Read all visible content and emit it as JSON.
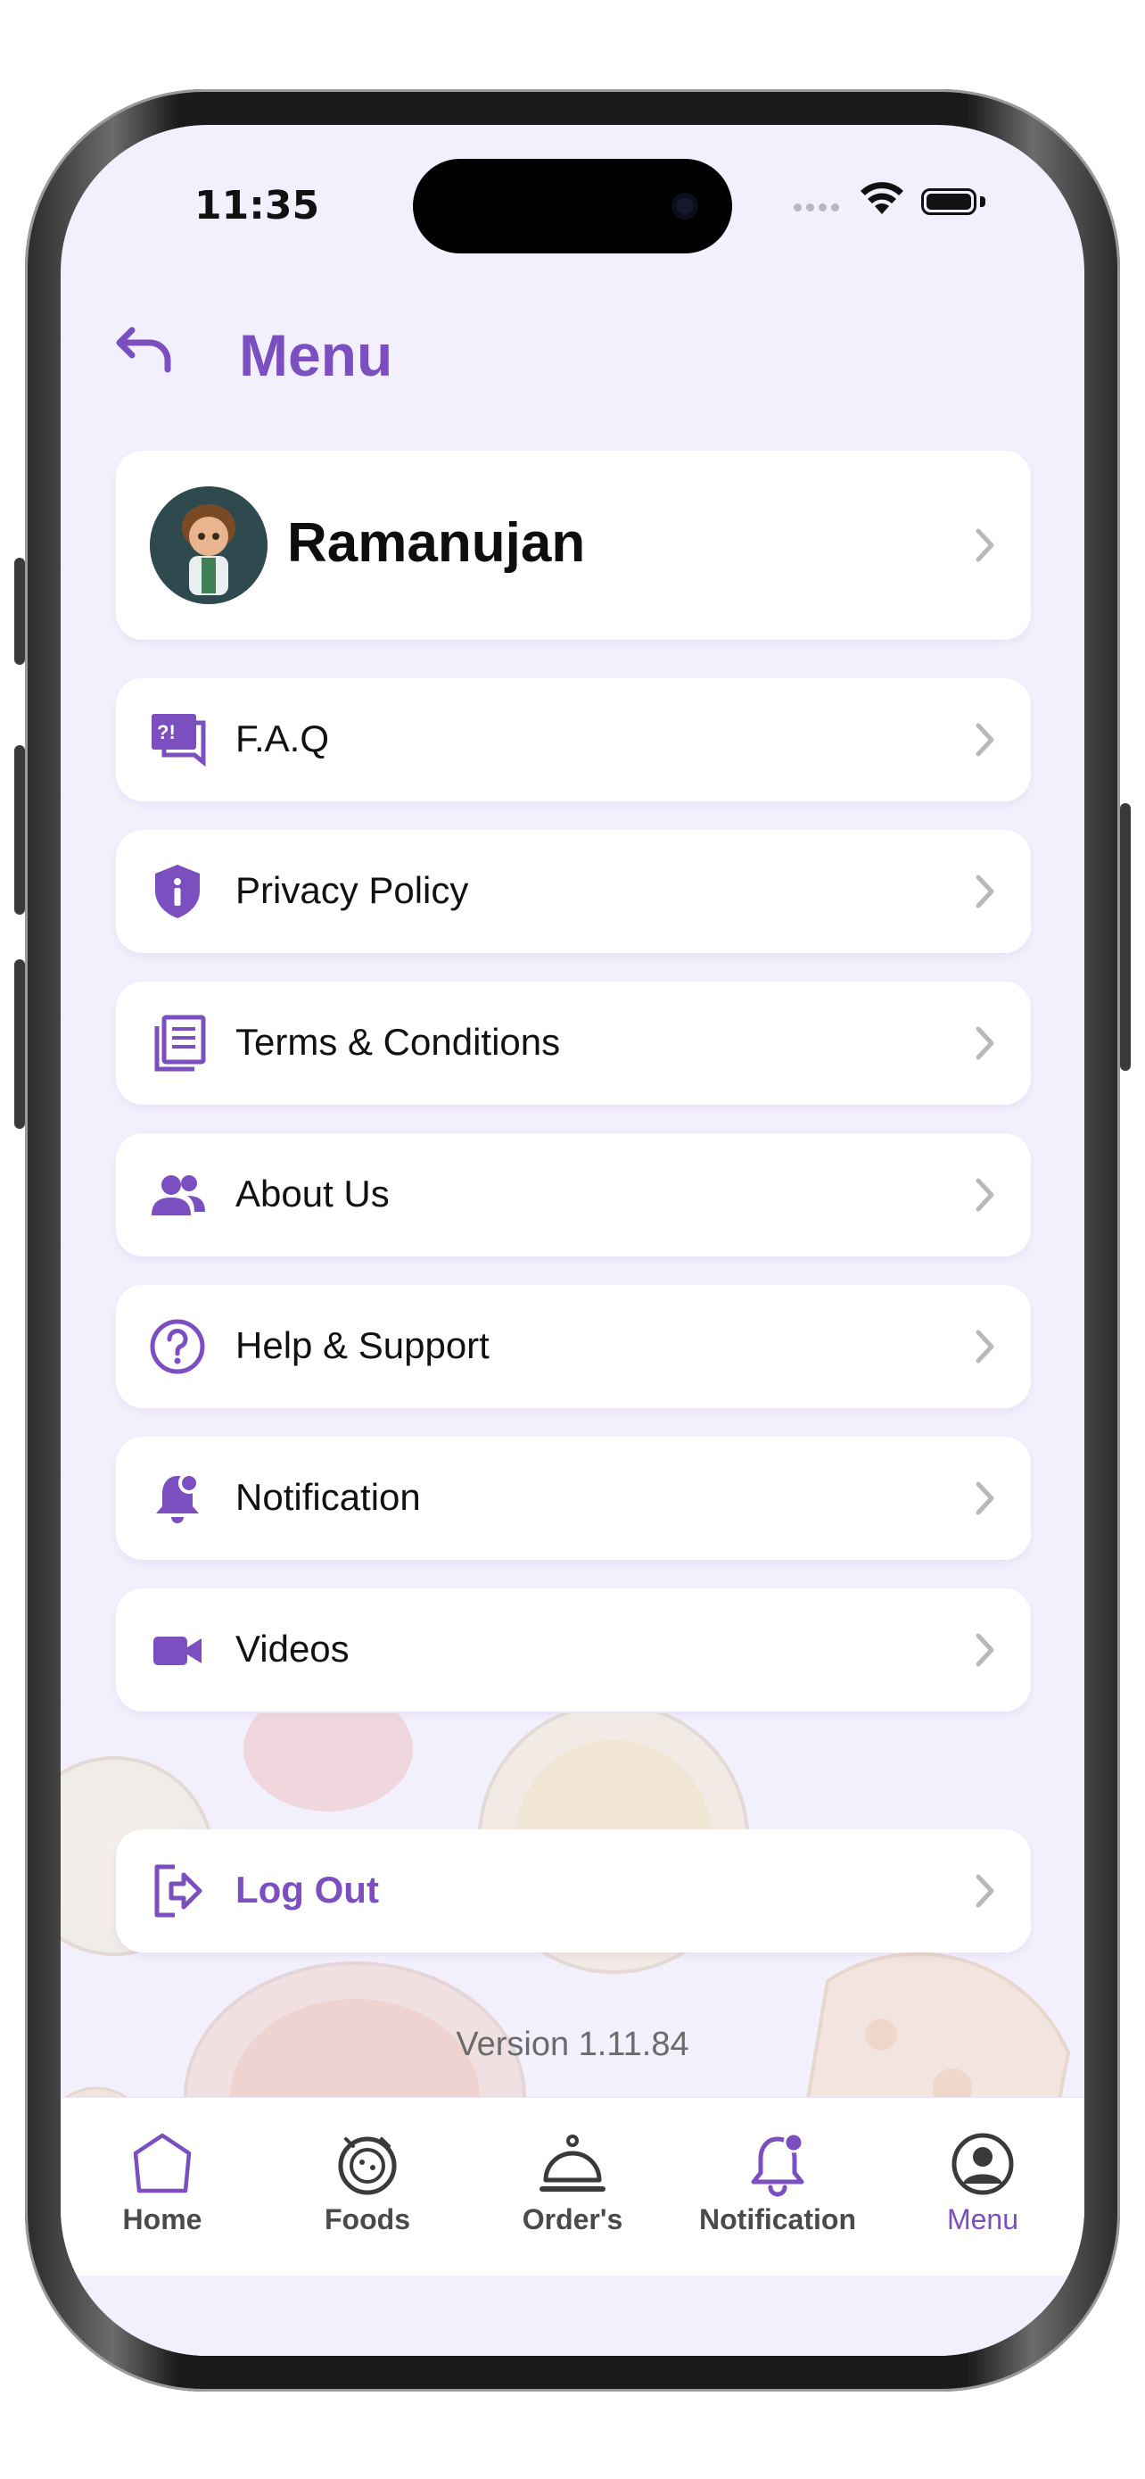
{
  "status_bar": {
    "time": "11:35"
  },
  "header": {
    "title": "Menu"
  },
  "profile": {
    "name": "Ramanujan"
  },
  "menu_items": [
    {
      "label": "F.A.Q",
      "icon": "faq-icon"
    },
    {
      "label": "Privacy Policy",
      "icon": "shield-info-icon"
    },
    {
      "label": "Terms & Conditions",
      "icon": "document-icon"
    },
    {
      "label": "About Us",
      "icon": "people-icon"
    },
    {
      "label": "Help & Support",
      "icon": "question-icon"
    },
    {
      "label": "Notification",
      "icon": "bell-icon"
    },
    {
      "label": "Videos",
      "icon": "video-icon"
    }
  ],
  "logout": {
    "label": "Log Out",
    "icon": "logout-icon"
  },
  "version": "Version 1.11.84",
  "bottom_nav": [
    {
      "label": "Home",
      "icon": "home-icon",
      "active": false
    },
    {
      "label": "Foods",
      "icon": "food-plate-icon",
      "active": false
    },
    {
      "label": "Order's",
      "icon": "cloche-icon",
      "active": false
    },
    {
      "label": "Notification",
      "icon": "bell-icon",
      "active": false
    },
    {
      "label": "Menu",
      "icon": "user-circle-icon",
      "active": true
    }
  ],
  "colors": {
    "accent": "#7b4fc0",
    "background": "#f3f0fd",
    "card": "#ffffff",
    "chevron": "#b9b9b9"
  }
}
